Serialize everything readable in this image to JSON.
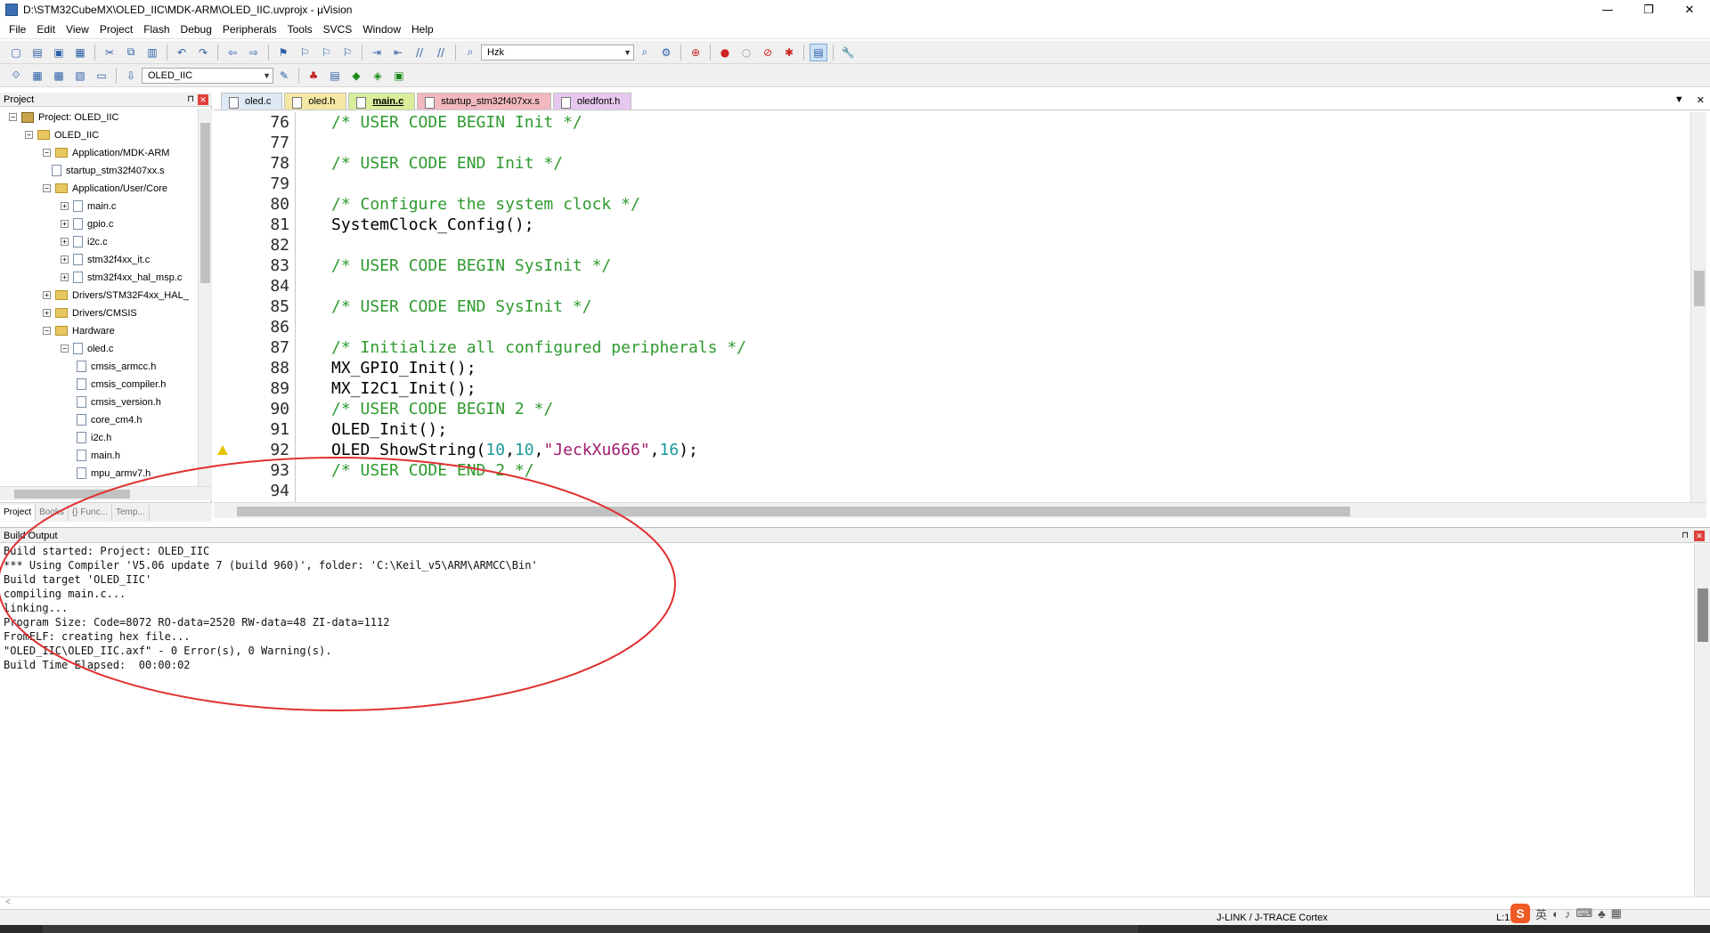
{
  "window": {
    "title": "D:\\STM32CubeMX\\OLED_IIC\\MDK-ARM\\OLED_IIC.uvprojx - µVision",
    "controls": [
      "—",
      "❐",
      "✕"
    ]
  },
  "menu": [
    "File",
    "Edit",
    "View",
    "Project",
    "Flash",
    "Debug",
    "Peripherals",
    "Tools",
    "SVCS",
    "Window",
    "Help"
  ],
  "toolbar1": {
    "find_combo": "Hzk"
  },
  "toolbar2": {
    "target_combo": "OLED_IIC"
  },
  "project_panel": {
    "title": "Project",
    "pin": "⊓",
    "close": "✕",
    "tree": [
      {
        "label": "Project: OLED_IIC",
        "exp": "−",
        "icon": "project"
      },
      {
        "label": "OLED_IIC",
        "exp": "−",
        "icon": "folder"
      },
      {
        "label": "Application/MDK-ARM",
        "exp": "−",
        "icon": "folder"
      },
      {
        "label": "startup_stm32f407xx.s",
        "exp": "",
        "icon": "file"
      },
      {
        "label": "Application/User/Core",
        "exp": "−",
        "icon": "folder"
      },
      {
        "label": "main.c",
        "exp": "+",
        "icon": "file"
      },
      {
        "label": "gpio.c",
        "exp": "+",
        "icon": "file"
      },
      {
        "label": "i2c.c",
        "exp": "+",
        "icon": "file"
      },
      {
        "label": "stm32f4xx_it.c",
        "exp": "+",
        "icon": "file"
      },
      {
        "label": "stm32f4xx_hal_msp.c",
        "exp": "+",
        "icon": "file"
      },
      {
        "label": "Drivers/STM32F4xx_HAL_",
        "exp": "+",
        "icon": "folder"
      },
      {
        "label": "Drivers/CMSIS",
        "exp": "+",
        "icon": "folder"
      },
      {
        "label": "Hardware",
        "exp": "−",
        "icon": "folder"
      },
      {
        "label": "oled.c",
        "exp": "−",
        "icon": "file"
      },
      {
        "label": "cmsis_armcc.h",
        "exp": "",
        "icon": "file"
      },
      {
        "label": "cmsis_compiler.h",
        "exp": "",
        "icon": "file"
      },
      {
        "label": "cmsis_version.h",
        "exp": "",
        "icon": "file"
      },
      {
        "label": "core_cm4.h",
        "exp": "",
        "icon": "file"
      },
      {
        "label": "i2c.h",
        "exp": "",
        "icon": "file"
      },
      {
        "label": "main.h",
        "exp": "",
        "icon": "file"
      },
      {
        "label": "mpu_armv7.h",
        "exp": "",
        "icon": "file"
      }
    ],
    "tabs": [
      "Project",
      "Books",
      "{} Func...",
      "Temp..."
    ]
  },
  "editor": {
    "tabs": [
      "oled.c",
      "oled.h",
      "main.c",
      "startup_stm32f407xx.s",
      "oledfont.h"
    ],
    "active_tab": "main.c",
    "lines": [
      {
        "n": "76",
        "parts": [
          {
            "t": "/* USER CODE BEGIN Init */",
            "c": "cm"
          }
        ]
      },
      {
        "n": "77",
        "parts": []
      },
      {
        "n": "78",
        "parts": [
          {
            "t": "/* USER CODE END Init */",
            "c": "cm"
          }
        ]
      },
      {
        "n": "79",
        "parts": []
      },
      {
        "n": "80",
        "parts": [
          {
            "t": "/* Configure the system clock */",
            "c": "cm"
          }
        ]
      },
      {
        "n": "81",
        "parts": [
          {
            "t": "SystemClock_Config();",
            "c": ""
          }
        ]
      },
      {
        "n": "82",
        "parts": []
      },
      {
        "n": "83",
        "parts": [
          {
            "t": "/* USER CODE BEGIN SysInit */",
            "c": "cm"
          }
        ]
      },
      {
        "n": "84",
        "parts": []
      },
      {
        "n": "85",
        "parts": [
          {
            "t": "/* USER CODE END SysInit */",
            "c": "cm"
          }
        ]
      },
      {
        "n": "86",
        "parts": []
      },
      {
        "n": "87",
        "parts": [
          {
            "t": "/* Initialize all configured peripherals */",
            "c": "cm"
          }
        ]
      },
      {
        "n": "88",
        "parts": [
          {
            "t": "MX_GPIO_Init();",
            "c": ""
          }
        ]
      },
      {
        "n": "89",
        "parts": [
          {
            "t": "MX_I2C1_Init();",
            "c": ""
          }
        ]
      },
      {
        "n": "90",
        "parts": [
          {
            "t": "/* USER CODE BEGIN 2 */",
            "c": "cm"
          }
        ]
      },
      {
        "n": "91",
        "parts": [
          {
            "t": "OLED_Init();",
            "c": ""
          }
        ]
      },
      {
        "n": "92",
        "warn": true,
        "parts": [
          {
            "t": "OLED_ShowString(",
            "c": ""
          },
          {
            "t": "10",
            "c": "num"
          },
          {
            "t": ",",
            "c": ""
          },
          {
            "t": "10",
            "c": "num"
          },
          {
            "t": ",",
            "c": ""
          },
          {
            "t": "\"JeckXu666\"",
            "c": "str"
          },
          {
            "t": ",",
            "c": ""
          },
          {
            "t": "16",
            "c": "num"
          },
          {
            "t": ");",
            "c": ""
          }
        ]
      },
      {
        "n": "93",
        "parts": [
          {
            "t": "/* USER CODE END 2 */",
            "c": "cm"
          }
        ]
      },
      {
        "n": "94",
        "parts": []
      }
    ]
  },
  "build_output": {
    "title": "Build Output",
    "lines": [
      "Build started: Project: OLED_IIC",
      "*** Using Compiler 'V5.06 update 7 (build 960)', folder: 'C:\\Keil_v5\\ARM\\ARMCC\\Bin'",
      "Build target 'OLED_IIC'",
      "compiling main.c...",
      "linking...",
      "Program Size: Code=8072 RO-data=2520 RW-data=48 ZI-data=1112",
      "FromELF: creating hex file...",
      "\"OLED_IIC\\OLED_IIC.axf\" - 0 Error(s), 0 Warning(s).",
      "Build Time Elapsed:  00:00:02"
    ]
  },
  "status": {
    "debugger": "J-LINK / J-TRACE Cortex",
    "position": "L:1"
  },
  "ime": {
    "logo": "S",
    "lang": "英"
  },
  "colors": {
    "comment": "#2e9a2e",
    "number": "#1a9a9a",
    "string": "#a01b6e",
    "annotation_circle": "#e03030"
  }
}
